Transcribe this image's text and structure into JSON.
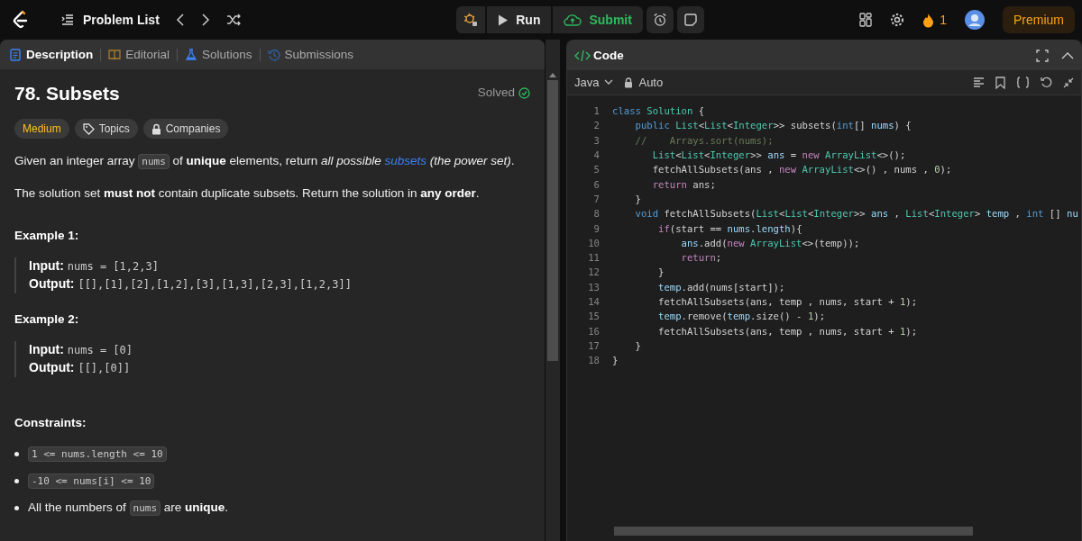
{
  "top_bar": {
    "problem_list": "Problem List",
    "run": "Run",
    "submit": "Submit",
    "streak": "1",
    "premium": "Premium"
  },
  "description_tabs": [
    {
      "label": "Description",
      "kind": "description",
      "selected": true
    },
    {
      "label": "Editorial",
      "kind": "editorial",
      "selected": false
    },
    {
      "label": "Solutions",
      "kind": "solutions",
      "selected": false
    },
    {
      "label": "Submissions",
      "kind": "submissions",
      "selected": false
    }
  ],
  "problem": {
    "title": "78. Subsets",
    "status": "Solved",
    "difficulty": "Medium",
    "tags": [
      {
        "label": "Topics",
        "kind": "tag"
      },
      {
        "label": "Companies",
        "kind": "locked"
      }
    ],
    "paragraphs": [
      [
        {
          "kind": "text",
          "text": "Given an integer array "
        },
        {
          "kind": "code",
          "text": "nums"
        },
        {
          "kind": "text",
          "text": " of **unique** elements, return *all possible* "
        },
        {
          "kind": "link",
          "text": "subsets"
        },
        {
          "kind": "text",
          "text": " *(the power set)*."
        }
      ],
      [
        {
          "kind": "text",
          "text": "The solution set **must not** contain duplicate subsets. Return the solution in **any order**."
        }
      ]
    ],
    "examples": [
      {
        "heading": "Example 1:",
        "rows": [
          {
            "label": "Input:",
            "value": "nums = [1,2,3]"
          },
          {
            "label": "Output:",
            "value": "[[],[1],[2],[1,2],[3],[1,3],[2,3],[1,2,3]]"
          }
        ]
      },
      {
        "heading": "Example 2:",
        "rows": [
          {
            "label": "Input:",
            "value": "nums = [0]"
          },
          {
            "label": "Output:",
            "value": "[[],[0]]"
          }
        ]
      }
    ],
    "constraints_heading": "Constraints:",
    "constraints": [
      [
        {
          "kind": "code",
          "text": "1 <= nums.length <= 10"
        }
      ],
      [
        {
          "kind": "code",
          "text": "-10 <= nums[i] <= 10"
        }
      ],
      [
        {
          "kind": "text",
          "text": "All the numbers of "
        },
        {
          "kind": "code",
          "text": "nums"
        },
        {
          "kind": "text",
          "text": " are **unique**."
        }
      ]
    ]
  },
  "code_panel": {
    "title": "Code",
    "language": "Java",
    "mode": "Auto",
    "lines": [
      {
        "number": "1",
        "tokens": [
          {
            "kind": "keyword",
            "text": "class"
          },
          {
            "kind": "type",
            "text": " Solution"
          },
          {
            "kind": "plain",
            "text": " {"
          }
        ]
      },
      {
        "number": "2",
        "tokens": [
          {
            "kind": "keyword",
            "text": "    public"
          },
          {
            "kind": "type",
            "text": " List"
          },
          {
            "kind": "plain",
            "text": "<"
          },
          {
            "kind": "type",
            "text": "List"
          },
          {
            "kind": "plain",
            "text": "<"
          },
          {
            "kind": "type",
            "text": "Integer"
          },
          {
            "kind": "plain",
            "text": ">> subsets("
          },
          {
            "kind": "keyword",
            "text": "int"
          },
          {
            "kind": "plain",
            "text": "[] "
          },
          {
            "kind": "variable",
            "text": "nums"
          },
          {
            "kind": "plain",
            "text": ") {"
          }
        ]
      },
      {
        "number": "3",
        "tokens": [
          {
            "kind": "comment",
            "text": "    //    Arrays.sort(nums);"
          }
        ]
      },
      {
        "number": "4",
        "tokens": [
          {
            "kind": "type",
            "text": "       List"
          },
          {
            "kind": "plain",
            "text": "<"
          },
          {
            "kind": "type",
            "text": "List"
          },
          {
            "kind": "plain",
            "text": "<"
          },
          {
            "kind": "type",
            "text": "Integer"
          },
          {
            "kind": "plain",
            "text": ">> "
          },
          {
            "kind": "variable",
            "text": "ans"
          },
          {
            "kind": "plain",
            "text": " = "
          },
          {
            "kind": "control",
            "text": "new"
          },
          {
            "kind": "type",
            "text": " ArrayList"
          },
          {
            "kind": "plain",
            "text": "<>();"
          }
        ]
      },
      {
        "number": "5",
        "tokens": [
          {
            "kind": "plain",
            "text": "       fetchAllSubsets(ans , "
          },
          {
            "kind": "control",
            "text": "new"
          },
          {
            "kind": "type",
            "text": " ArrayList"
          },
          {
            "kind": "plain",
            "text": "<>() , nums , "
          },
          {
            "kind": "number",
            "text": "0"
          },
          {
            "kind": "plain",
            "text": ");"
          }
        ]
      },
      {
        "number": "6",
        "tokens": [
          {
            "kind": "control",
            "text": "       return"
          },
          {
            "kind": "plain",
            "text": " ans;"
          }
        ]
      },
      {
        "number": "7",
        "tokens": [
          {
            "kind": "plain",
            "text": "    }"
          }
        ]
      },
      {
        "number": "8",
        "tokens": [
          {
            "kind": "keyword",
            "text": "    void"
          },
          {
            "kind": "plain",
            "text": " fetchAllSubsets("
          },
          {
            "kind": "type",
            "text": "List"
          },
          {
            "kind": "plain",
            "text": "<"
          },
          {
            "kind": "type",
            "text": "List"
          },
          {
            "kind": "plain",
            "text": "<"
          },
          {
            "kind": "type",
            "text": "Integer"
          },
          {
            "kind": "plain",
            "text": ">> "
          },
          {
            "kind": "variable",
            "text": "ans"
          },
          {
            "kind": "plain",
            "text": " , "
          },
          {
            "kind": "type",
            "text": "List"
          },
          {
            "kind": "plain",
            "text": "<"
          },
          {
            "kind": "type",
            "text": "Integer"
          },
          {
            "kind": "plain",
            "text": "> "
          },
          {
            "kind": "variable",
            "text": "temp"
          },
          {
            "kind": "plain",
            "text": " , "
          },
          {
            "kind": "keyword",
            "text": "int"
          },
          {
            "kind": "plain",
            "text": " [] "
          },
          {
            "kind": "variable",
            "text": "nu"
          }
        ]
      },
      {
        "number": "9",
        "tokens": [
          {
            "kind": "control",
            "text": "        if"
          },
          {
            "kind": "plain",
            "text": "(start == "
          },
          {
            "kind": "variable",
            "text": "nums"
          },
          {
            "kind": "plain",
            "text": "."
          },
          {
            "kind": "variable",
            "text": "length"
          },
          {
            "kind": "plain",
            "text": "){"
          }
        ]
      },
      {
        "number": "10",
        "tokens": [
          {
            "kind": "variable",
            "text": "            ans"
          },
          {
            "kind": "plain",
            "text": ".add("
          },
          {
            "kind": "control",
            "text": "new"
          },
          {
            "kind": "type",
            "text": " ArrayList"
          },
          {
            "kind": "plain",
            "text": "<>(temp));"
          }
        ]
      },
      {
        "number": "11",
        "tokens": [
          {
            "kind": "control",
            "text": "            return"
          },
          {
            "kind": "plain",
            "text": ";"
          }
        ]
      },
      {
        "number": "12",
        "tokens": [
          {
            "kind": "plain",
            "text": "        }"
          }
        ]
      },
      {
        "number": "13",
        "tokens": [
          {
            "kind": "variable",
            "text": "        temp"
          },
          {
            "kind": "plain",
            "text": ".add(nums[start]);"
          }
        ]
      },
      {
        "number": "14",
        "tokens": [
          {
            "kind": "plain",
            "text": "        fetchAllSubsets(ans, temp , nums, start + "
          },
          {
            "kind": "number",
            "text": "1"
          },
          {
            "kind": "plain",
            "text": ");"
          }
        ]
      },
      {
        "number": "15",
        "tokens": [
          {
            "kind": "variable",
            "text": "        temp"
          },
          {
            "kind": "plain",
            "text": ".remove("
          },
          {
            "kind": "variable",
            "text": "temp"
          },
          {
            "kind": "plain",
            "text": ".size() - "
          },
          {
            "kind": "number",
            "text": "1"
          },
          {
            "kind": "plain",
            "text": ");"
          }
        ]
      },
      {
        "number": "16",
        "tokens": [
          {
            "kind": "plain",
            "text": "        fetchAllSubsets(ans, temp , nums, start + "
          },
          {
            "kind": "number",
            "text": "1"
          },
          {
            "kind": "plain",
            "text": ");"
          }
        ]
      },
      {
        "number": "17",
        "tokens": [
          {
            "kind": "plain",
            "text": "    }"
          }
        ]
      },
      {
        "number": "18",
        "tokens": [
          {
            "kind": "plain",
            "text": "}"
          }
        ]
      }
    ]
  }
}
